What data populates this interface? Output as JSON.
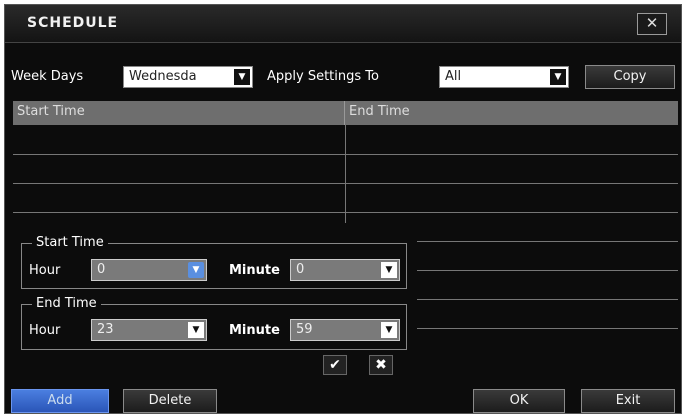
{
  "window": {
    "title": "SCHEDULE"
  },
  "icons": {
    "close": "close-icon",
    "check": "check-icon",
    "cancel": "x-icon",
    "dropdown": "chevron-down-icon"
  },
  "toolbar": {
    "week_days_label": "Week Days",
    "week_days_value": "Wednesda",
    "apply_label": "Apply Settings To",
    "apply_value": "All",
    "copy_label": "Copy"
  },
  "table": {
    "columns": [
      "Start Time",
      "End Time"
    ]
  },
  "start_time": {
    "legend": "Start Time",
    "hour_label": "Hour",
    "hour_value": "0",
    "minute_label": "Minute",
    "minute_value": "0"
  },
  "end_time": {
    "legend": "End Time",
    "hour_label": "Hour",
    "hour_value": "23",
    "minute_label": "Minute",
    "minute_value": "59"
  },
  "footer": {
    "add_label": "Add",
    "delete_label": "Delete",
    "ok_label": "OK",
    "exit_label": "Exit"
  },
  "colors": {
    "accent": "#3f6fd6",
    "background": "#0c0c0c",
    "header": "#6e6e6e"
  }
}
